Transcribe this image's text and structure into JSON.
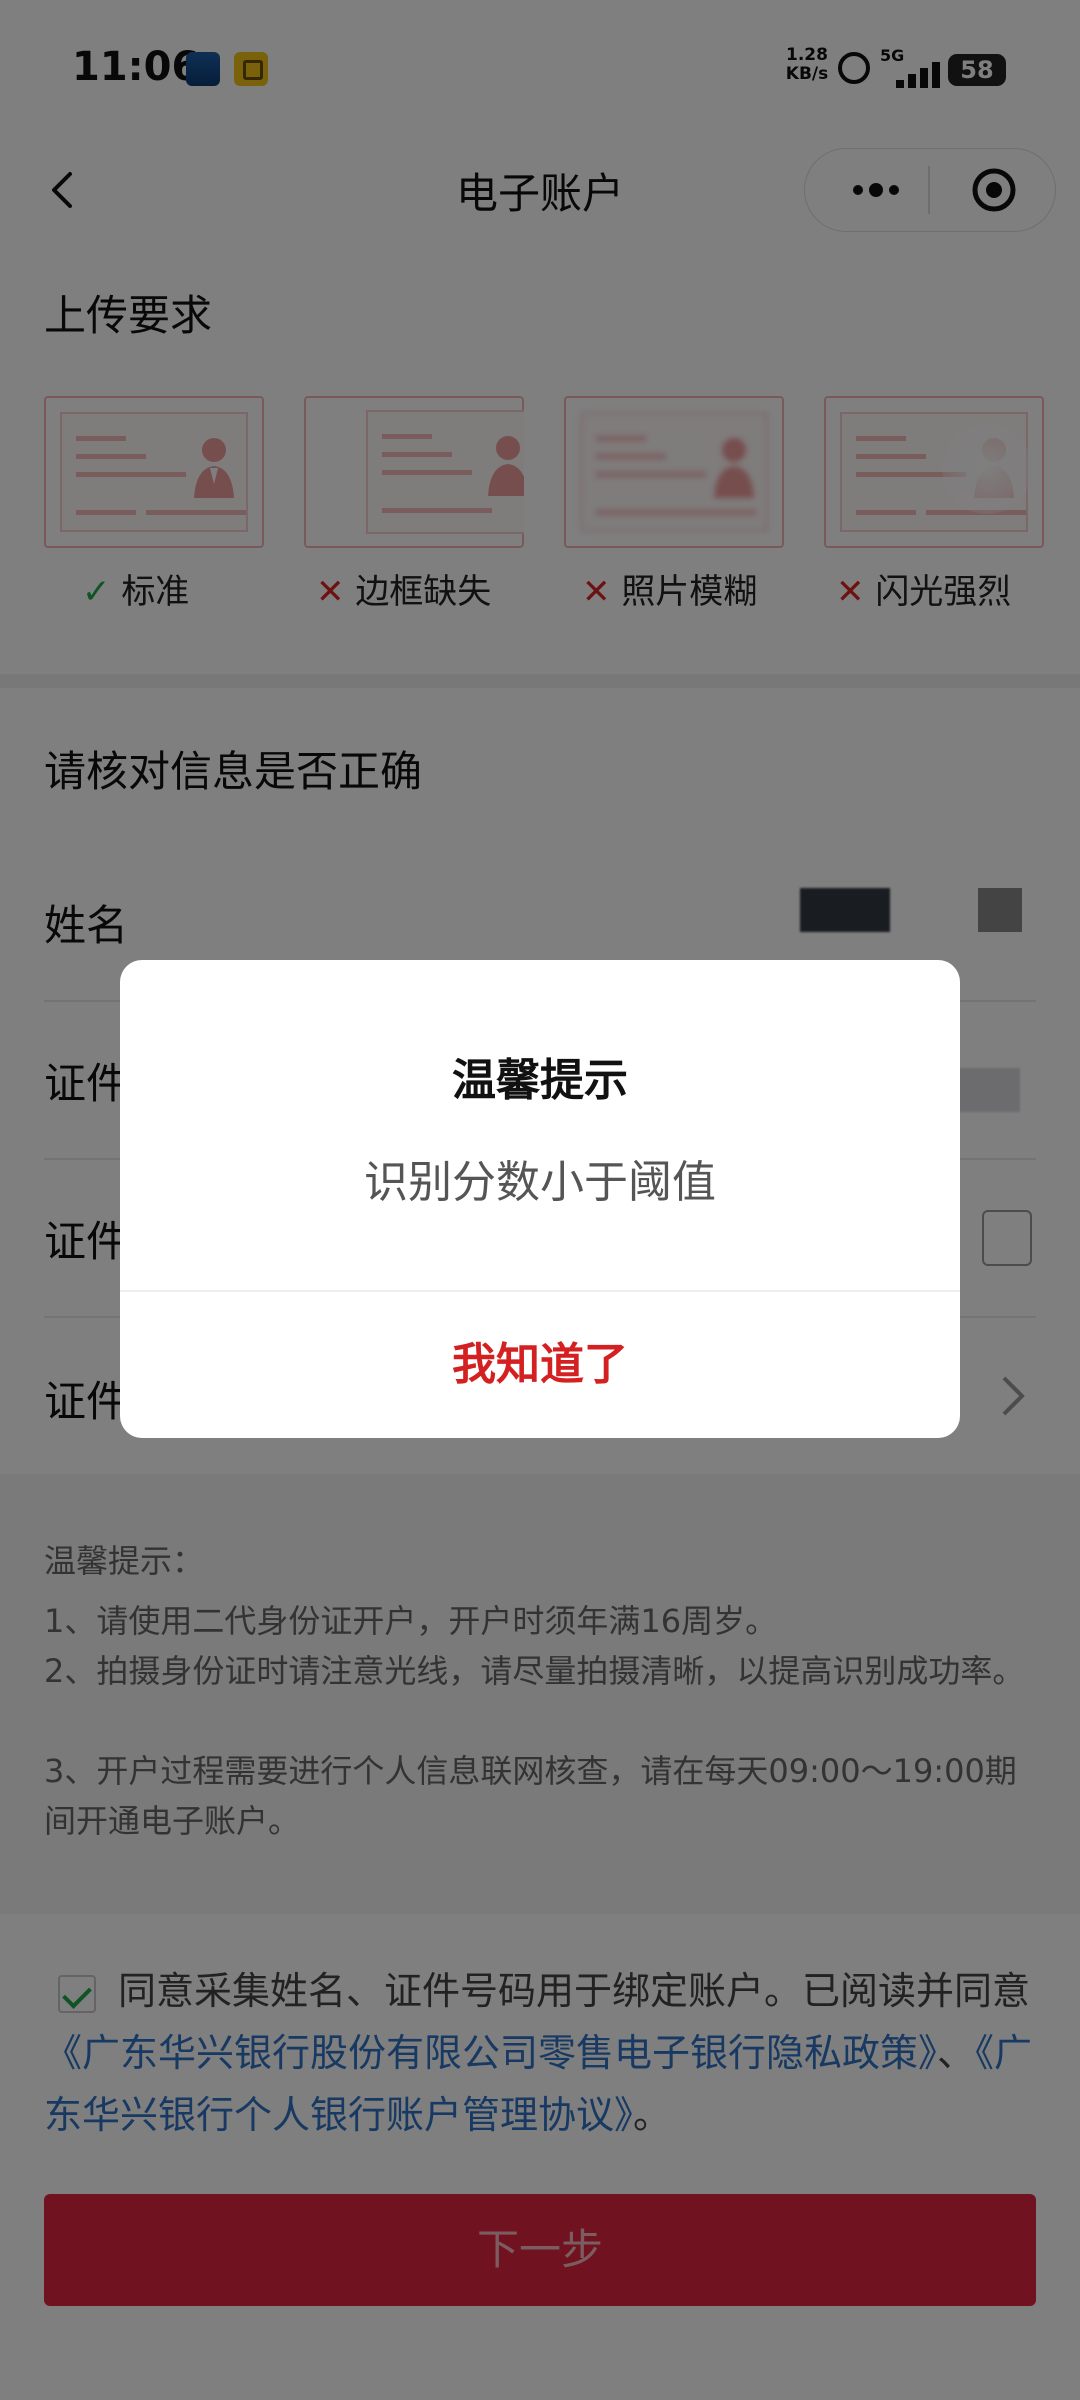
{
  "status_bar": {
    "time": "11:06",
    "net_speed_value": "1.28",
    "net_speed_unit": "KB/s",
    "network": "5G",
    "battery": "58"
  },
  "nav": {
    "title": "电子账户",
    "back_icon": "chevron-left-icon",
    "more_icon": "more-dots-icon",
    "close_icon": "target-icon"
  },
  "upload": {
    "title": "上传要求",
    "samples": [
      {
        "label": "标准",
        "status": "ok"
      },
      {
        "label": "边框缺失",
        "status": "bad"
      },
      {
        "label": "照片模糊",
        "status": "bad"
      },
      {
        "label": "闪光强烈",
        "status": "bad"
      }
    ]
  },
  "verify": {
    "title": "请核对信息是否正确",
    "rows": [
      {
        "label": "姓名"
      },
      {
        "label": "证件"
      },
      {
        "label": "证件"
      },
      {
        "label": "证件"
      }
    ]
  },
  "tips": {
    "title": "温馨提示：",
    "items": [
      "1、请使用二代身份证开户，开户时须年满16周岁。",
      "2、拍摄身份证时请注意光线，请尽量拍摄清晰，以提高识别成功率。",
      "3、开户过程需要进行个人信息联网核查，请在每天09:00～19:00期间开通电子账户。"
    ]
  },
  "agreement": {
    "text_before": "同意采集姓名、证件号码用于绑定账户。已阅读并同意",
    "link1": "《广东华兴银行股份有限公司零售电子银行隐私政策》",
    "separator": "、",
    "link2": "《广东华兴银行个人银行账户管理协议》",
    "text_after": "。"
  },
  "next_button": "下一步",
  "dialog": {
    "title": "温馨提示",
    "message": "识别分数小于阈值",
    "confirm": "我知道了"
  },
  "colors": {
    "accent": "#e0253f",
    "link": "#2f72c4",
    "ok": "#21a84d",
    "error": "#d22222"
  }
}
